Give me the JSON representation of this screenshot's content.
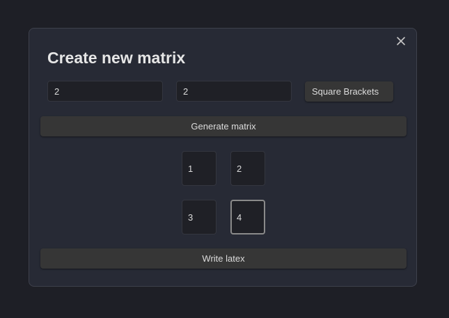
{
  "dialog": {
    "title": "Create new matrix",
    "close_icon": "close-icon"
  },
  "form": {
    "rows_value": "2",
    "columns_value": "2",
    "bracket_style": "Square Brackets",
    "generate_label": "Generate matrix"
  },
  "matrix": {
    "cells": [
      "1",
      "2",
      "3",
      "4"
    ],
    "focused_cell": 3
  },
  "actions": {
    "write_label": "Write latex"
  },
  "colors": {
    "page_background": "#1e1f26",
    "modal_background": "#272a35",
    "input_background": "#1f2026",
    "button_background": "#363636",
    "text": "#dcdcdc",
    "focus_border": "#8a8a8a"
  }
}
